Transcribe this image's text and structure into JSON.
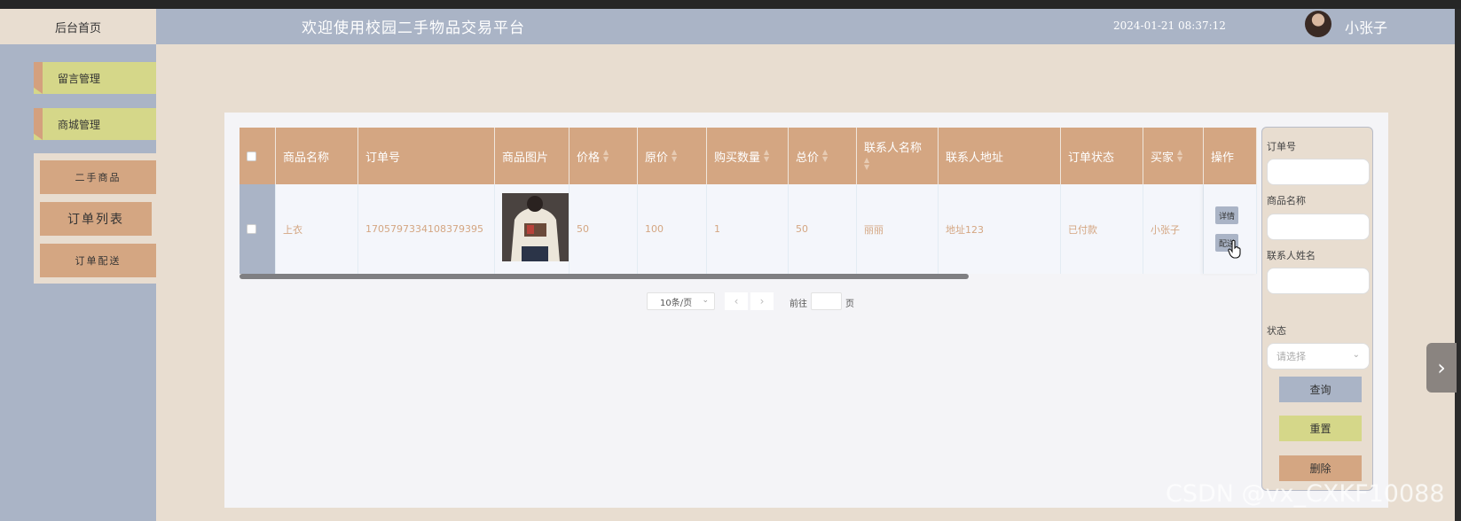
{
  "header": {
    "home": "后台首页",
    "title": "欢迎使用校园二手物品交易平台",
    "datetime": "2024-01-21 08:37:12",
    "username": "小张子"
  },
  "sidebar": {
    "items": [
      "留言管理",
      "商城管理"
    ],
    "subitems": [
      "二手商品",
      "订单列表",
      "订单配送"
    ]
  },
  "table": {
    "headers": [
      "商品名称",
      "订单号",
      "商品图片",
      "价格",
      "原价",
      "购买数量",
      "总价",
      "联系人名称",
      "联系人地址",
      "订单状态",
      "买家",
      "操作"
    ],
    "rows": [
      {
        "name": "上衣",
        "order_no": "1705797334108379395",
        "price": "50",
        "original_price": "100",
        "quantity": "1",
        "total": "50",
        "contact_name": "丽丽",
        "contact_address": "地址123",
        "status": "已付款",
        "buyer": "小张子",
        "actions": [
          "详情",
          "配送"
        ]
      }
    ]
  },
  "pager": {
    "page_size": "10条/页",
    "goto_prefix": "前往",
    "goto_suffix": "页"
  },
  "search": {
    "labels": [
      "订单号",
      "商品名称",
      "联系人姓名",
      "状态"
    ],
    "status_placeholder": "请选择",
    "buttons": [
      "查询",
      "重置",
      "删除"
    ]
  },
  "colors": {
    "header": "#aab4c6",
    "accent_tan": "#d4a682",
    "accent_olive": "#d5d789",
    "background": "#e8ddd0"
  },
  "watermark": "CSDN @vx_CXKF10088"
}
